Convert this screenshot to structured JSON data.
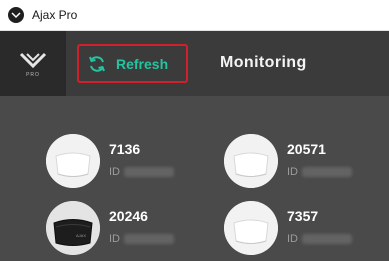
{
  "window": {
    "title": "Ajax Pro"
  },
  "logo": {
    "sub": "PRO"
  },
  "toolbar": {
    "refresh_label": "Refresh"
  },
  "header": {
    "title": "Monitoring"
  },
  "devices": [
    {
      "name": "7136",
      "id_label": "ID",
      "color": "white"
    },
    {
      "name": "20571",
      "id_label": "ID",
      "color": "white"
    },
    {
      "name": "20246",
      "id_label": "ID",
      "color": "black"
    },
    {
      "name": "7357",
      "id_label": "ID",
      "color": "white"
    }
  ],
  "colors": {
    "accent": "#23c4a0",
    "highlight": "#d0212a",
    "background": "#4a4a4a"
  }
}
